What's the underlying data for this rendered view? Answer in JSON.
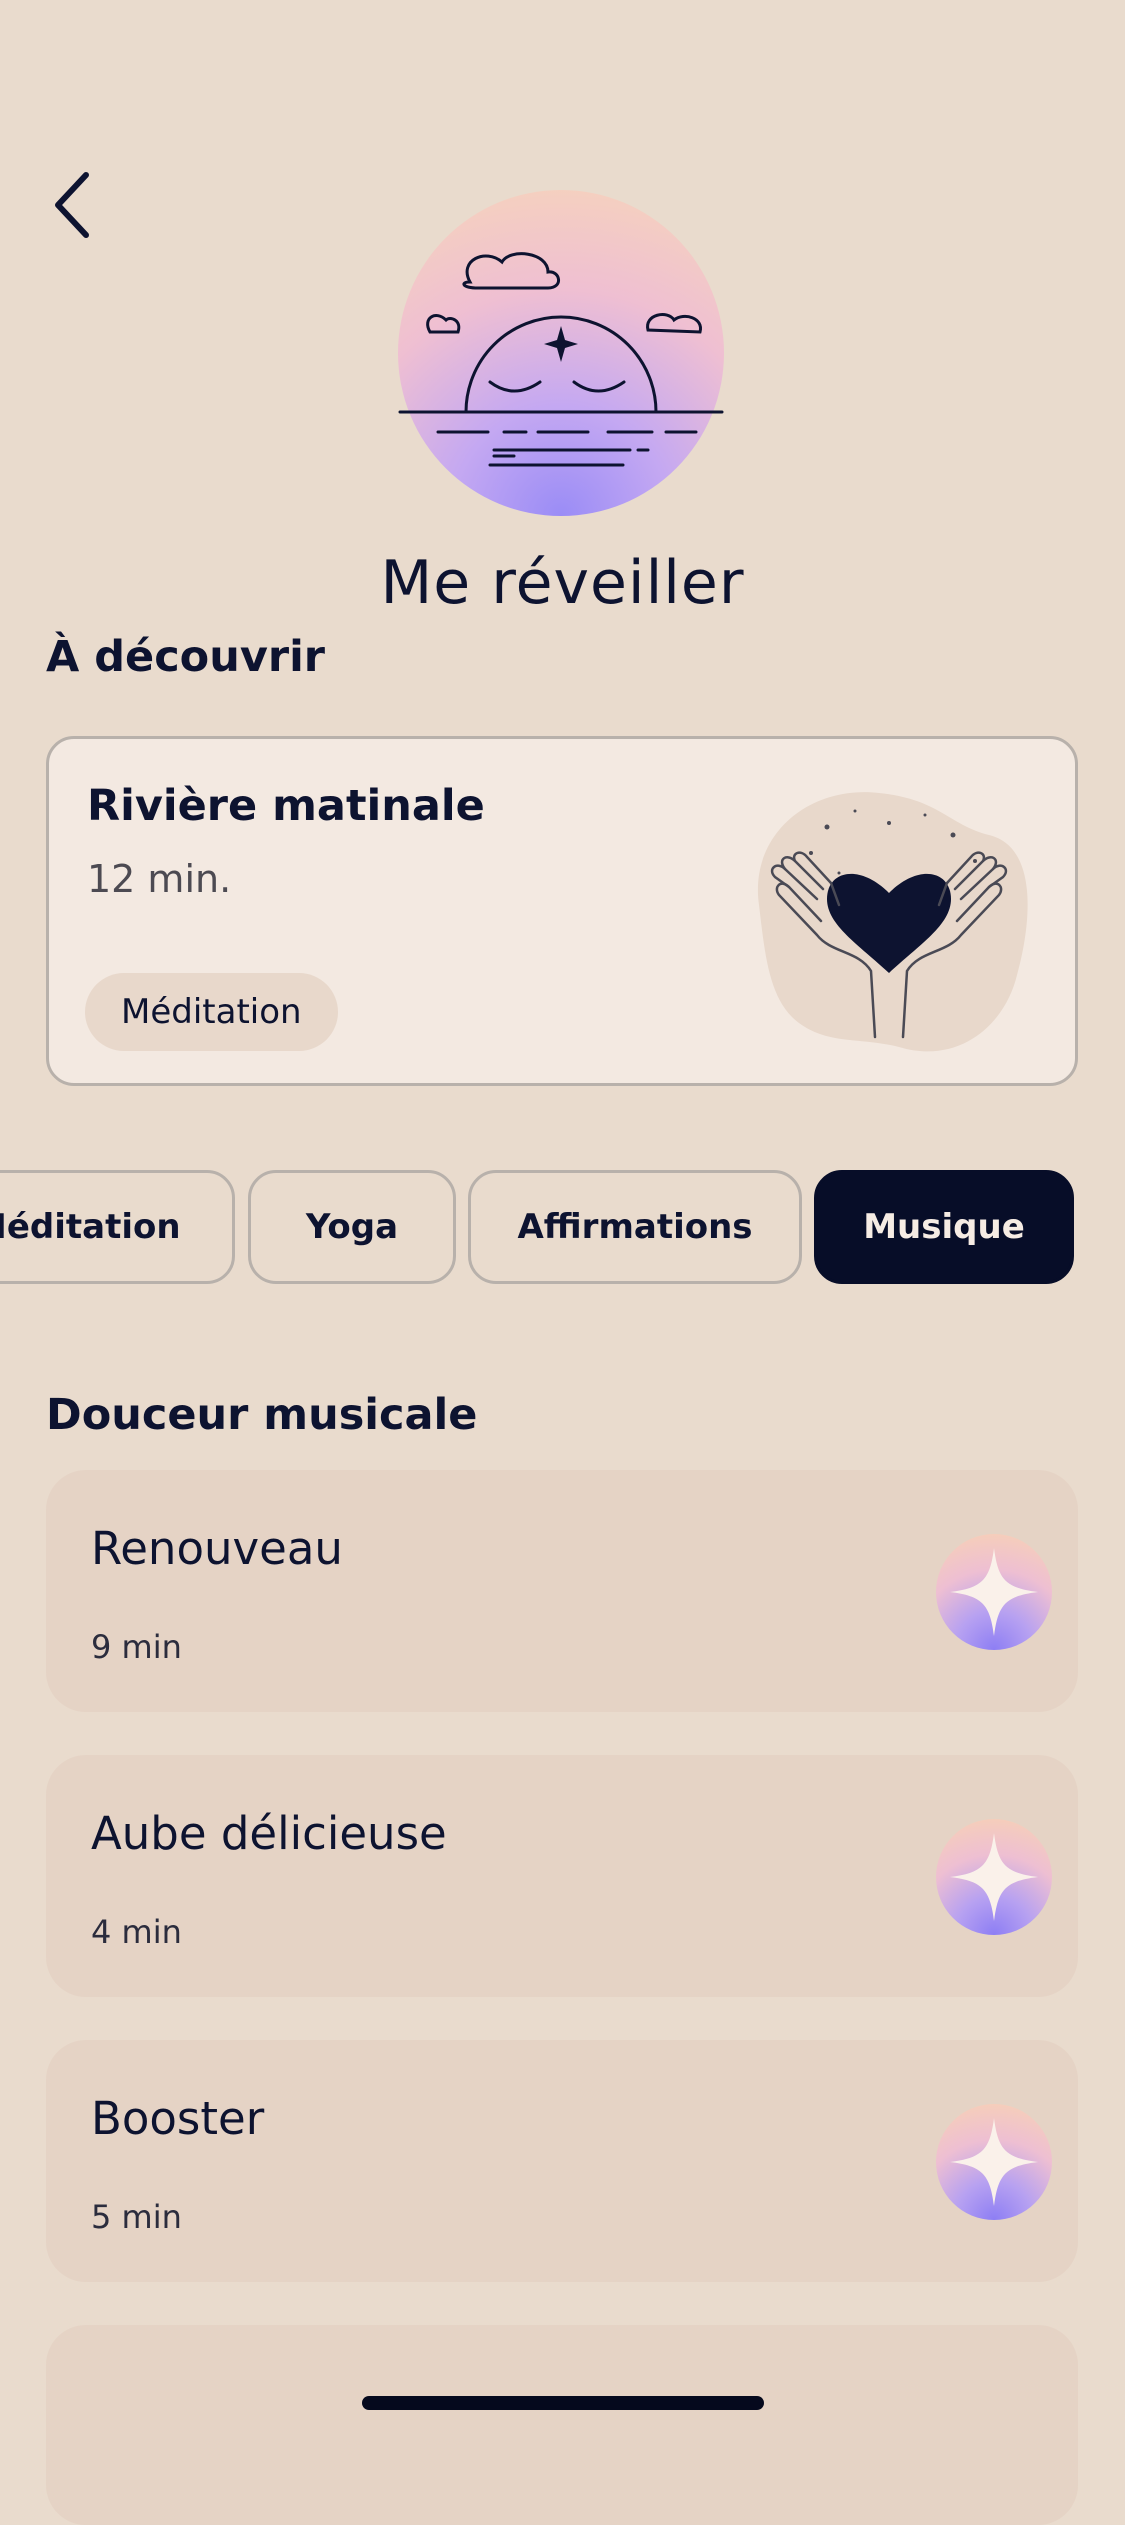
{
  "header": {
    "back_icon": "chevron-left-icon",
    "hero_icon": "sunrise-illustration",
    "title": "Me réveiller"
  },
  "discover": {
    "heading": "À découvrir",
    "featured": {
      "title": "Rivière matinale",
      "duration": "12 min.",
      "tag": "Méditation",
      "illustration": "hands-heart-illustration"
    }
  },
  "tabs": [
    {
      "label": "Méditation",
      "selected": false
    },
    {
      "label": "Yoga",
      "selected": false
    },
    {
      "label": "Affirmations",
      "selected": false
    },
    {
      "label": "Musique",
      "selected": true
    }
  ],
  "section": {
    "heading": "Douceur musicale",
    "tracks": [
      {
        "title": "Renouveau",
        "duration": "9 min",
        "icon": "sparkle-icon"
      },
      {
        "title": "Aube délicieuse",
        "duration": "4 min",
        "icon": "sparkle-icon"
      },
      {
        "title": "Booster",
        "duration": "5 min",
        "icon": "sparkle-icon"
      }
    ]
  },
  "colors": {
    "background": "#e9dbcd",
    "text": "#0d1330",
    "selected_tab": "#070d28",
    "card": "#e5d3c5"
  }
}
